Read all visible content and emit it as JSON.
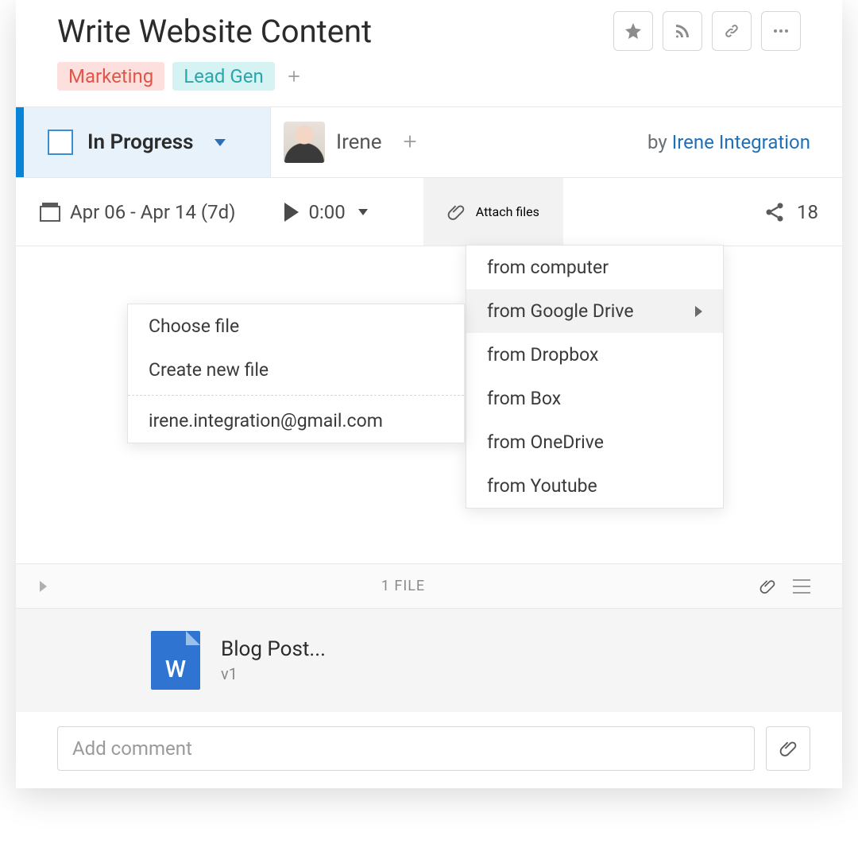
{
  "header": {
    "title": "Write Website Content",
    "tags": [
      {
        "label": "Marketing",
        "bg": "#fde0dd",
        "fg": "#e0574a"
      },
      {
        "label": "Lead Gen",
        "bg": "#d5f3f2",
        "fg": "#2aa7ad"
      }
    ]
  },
  "status": {
    "label": "In Progress",
    "assignee": "Irene",
    "by_prefix": "by",
    "by_name": "Irene Integration"
  },
  "meta": {
    "dates": "Apr 06 - Apr 14 (7d)",
    "timer": "0:00",
    "attach_label": "Attach files",
    "share_count": "18"
  },
  "attach_menu": {
    "items": [
      "from computer",
      "from Google Drive",
      "from Dropbox",
      "from Box",
      "from OneDrive",
      "from Youtube"
    ],
    "hover_index": 1
  },
  "drive_submenu": {
    "choose": "Choose file",
    "create": "Create new file",
    "account": "irene.integration@gmail.com"
  },
  "files": {
    "count_label": "1 FILE",
    "item": {
      "name": "Blog Post...",
      "version": "v1",
      "glyph": "W"
    }
  },
  "comment": {
    "placeholder": "Add comment"
  }
}
